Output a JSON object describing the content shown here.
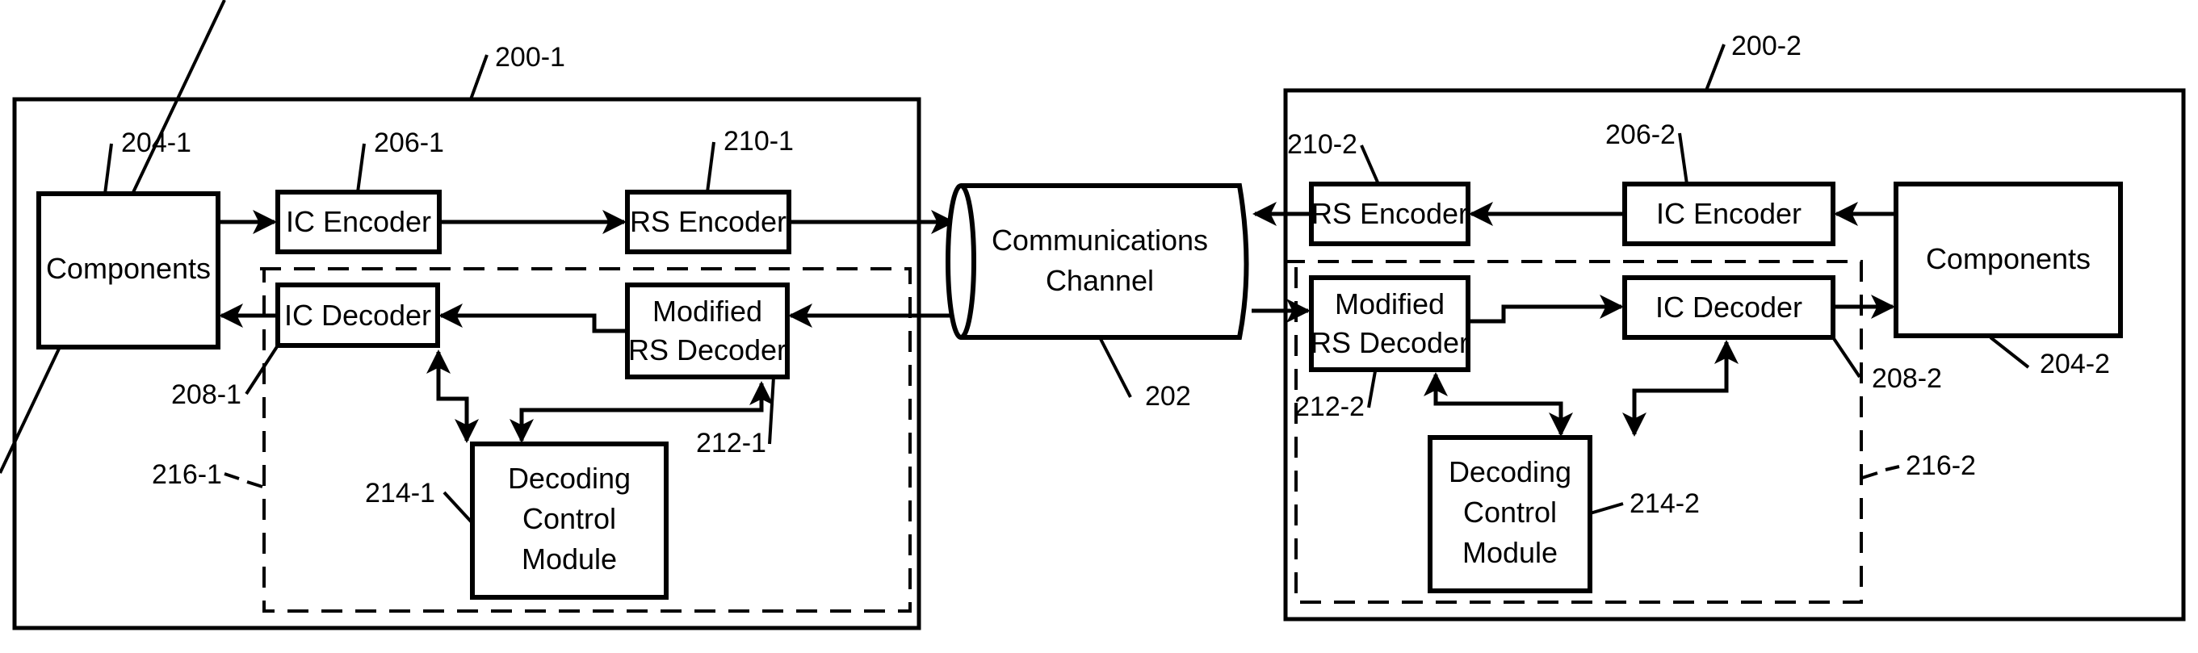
{
  "diagram": {
    "channel": {
      "label_line1": "Communications",
      "label_line2": "Channel",
      "ref": "202"
    },
    "device1": {
      "ref": "200-1",
      "components": {
        "label": "Components",
        "ref": "204-1"
      },
      "ic_encoder": {
        "label": "IC Encoder",
        "ref": "206-1"
      },
      "rs_encoder": {
        "label": "RS Encoder",
        "ref": "210-1"
      },
      "ic_decoder": {
        "label": "IC Decoder",
        "ref": "208-1"
      },
      "mod_rs_decoder": {
        "label_line1": "Modified",
        "label_line2": "RS Decoder",
        "ref": "212-1"
      },
      "dcm": {
        "label_line1": "Decoding",
        "label_line2": "Control",
        "label_line3": "Module",
        "ref": "214-1"
      },
      "decoder_group_ref": "216-1"
    },
    "device2": {
      "ref": "200-2",
      "components": {
        "label": "Components",
        "ref": "204-2"
      },
      "ic_encoder": {
        "label": "IC Encoder",
        "ref": "206-2"
      },
      "rs_encoder": {
        "label": "RS Encoder",
        "ref": "210-2"
      },
      "ic_decoder": {
        "label": "IC Decoder",
        "ref": "208-2"
      },
      "mod_rs_decoder": {
        "label_line1": "Modified",
        "label_line2": "RS Decoder",
        "ref": "212-2"
      },
      "dcm": {
        "label_line1": "Decoding",
        "label_line2": "Control",
        "label_line3": "Module",
        "ref": "214-2"
      },
      "decoder_group_ref": "216-2"
    }
  }
}
